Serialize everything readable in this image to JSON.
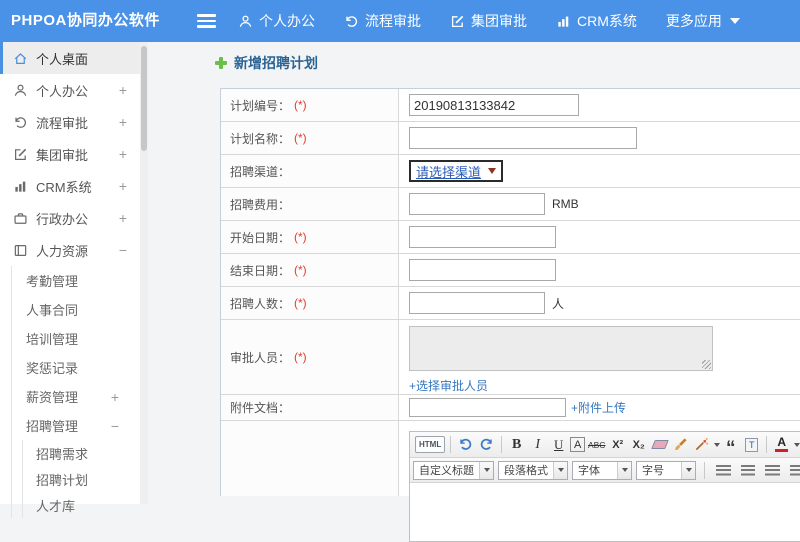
{
  "colors": {
    "topbar": "#4a92e8",
    "accent": "#4a90e2",
    "link": "#3677c0",
    "required": "#e53c2e",
    "page_title": "#2c6496"
  },
  "topbar": {
    "title": "PHPOA协同办公软件",
    "nav": [
      {
        "label": "个人办公",
        "icon": "user-icon"
      },
      {
        "label": "流程审批",
        "icon": "process-icon"
      },
      {
        "label": "集团审批",
        "icon": "edit-square-icon"
      },
      {
        "label": "CRM系统",
        "icon": "bar-chart-icon"
      },
      {
        "label": "更多应用",
        "icon": "caret-down-icon"
      }
    ]
  },
  "sidebar": {
    "items": [
      {
        "label": "个人桌面",
        "icon": "home-icon",
        "active": true
      },
      {
        "label": "个人办公",
        "icon": "user-icon",
        "toggle": "+"
      },
      {
        "label": "流程审批",
        "icon": "process-icon",
        "toggle": "+"
      },
      {
        "label": "集团审批",
        "icon": "edit-square-icon",
        "toggle": "+"
      },
      {
        "label": "CRM系统",
        "icon": "bar-chart-icon",
        "toggle": "+"
      },
      {
        "label": "行政办公",
        "icon": "briefcase-icon",
        "toggle": "+"
      },
      {
        "label": "人力资源",
        "icon": "id-card-icon",
        "toggle": "−"
      },
      {
        "label": "考勤管理"
      },
      {
        "label": "人事合同"
      },
      {
        "label": "培训管理"
      },
      {
        "label": "奖惩记录"
      },
      {
        "label": "薪资管理",
        "toggle": "+"
      },
      {
        "label": "招聘管理",
        "toggle": "−"
      },
      {
        "label": "招聘需求"
      },
      {
        "label": "招聘计划"
      },
      {
        "label": "人才库"
      }
    ]
  },
  "page": {
    "title": "新增招聘计划"
  },
  "form": {
    "rows": [
      {
        "label": "计划编号：",
        "req": "(*)",
        "value": "20190813133842"
      },
      {
        "label": "计划名称：",
        "req": "(*)",
        "value": ""
      },
      {
        "label": "招聘渠道：",
        "select_value": "请选择渠道"
      },
      {
        "label": "招聘费用：",
        "suffix": "RMB"
      },
      {
        "label": "开始日期：",
        "req": "(*)"
      },
      {
        "label": "结束日期：",
        "req": "(*)"
      },
      {
        "label": "招聘人数：",
        "req": "(*)",
        "suffix": "人"
      },
      {
        "label": "审批人员：",
        "req": "(*)",
        "link": "+选择审批人员"
      },
      {
        "label": "附件文档：",
        "link": "+附件上传"
      }
    ]
  },
  "editor": {
    "html_button": "HTML",
    "bold": "B",
    "italic": "I",
    "underline": "U",
    "font_box": "A",
    "strike": "ABC",
    "superscript": "X²",
    "subscript": "X₂",
    "quote": "“",
    "forecolor": "A",
    "backcolor": "ab",
    "link_glyph": "∞",
    "dropdowns": [
      {
        "label": "自定义标题"
      },
      {
        "label": "段落格式"
      },
      {
        "label": "字体"
      },
      {
        "label": "字号"
      }
    ]
  }
}
